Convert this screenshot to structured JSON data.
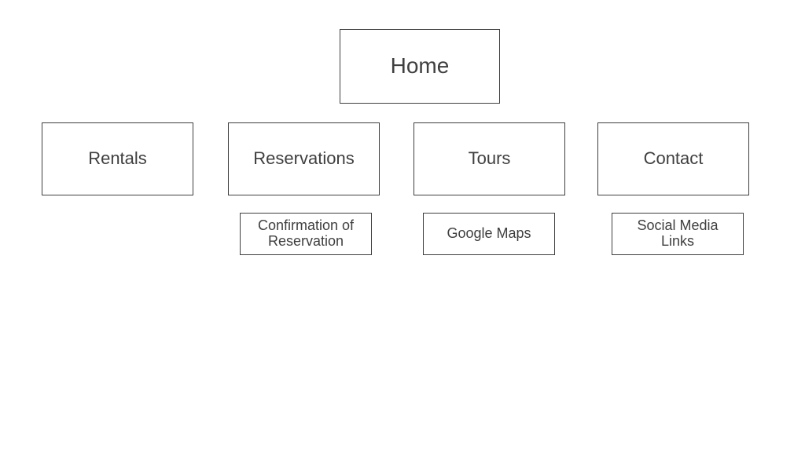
{
  "sitemap": {
    "home": "Home",
    "sections": [
      {
        "label": "Rentals"
      },
      {
        "label": "Reservations",
        "child": "Confirmation of\nReservation"
      },
      {
        "label": "Tours",
        "child": "Google Maps"
      },
      {
        "label": "Contact",
        "child": "Social Media\nLinks"
      }
    ]
  }
}
